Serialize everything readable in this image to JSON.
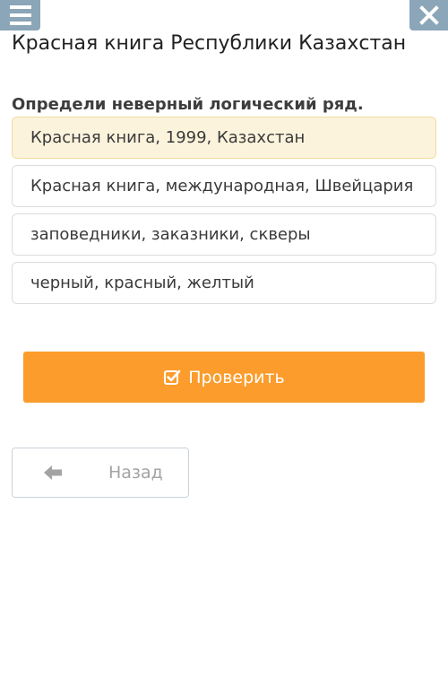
{
  "header": {
    "menu_icon": "hamburger-icon",
    "close_icon": "close-icon",
    "title": "Красная книга Республики Казахстан"
  },
  "question": {
    "text": "Определи неверный логический ряд."
  },
  "options": [
    {
      "label": "Красная книга, 1999, Казахстан",
      "selected": true
    },
    {
      "label": "Красная книга, международная, Швейцария",
      "selected": false
    },
    {
      "label": "заповедники, заказники, скверы",
      "selected": false
    },
    {
      "label": "черный, красный, желтый",
      "selected": false
    }
  ],
  "actions": {
    "check_label": "Проверить",
    "check_icon": "checkbox-icon",
    "back_label": "Назад",
    "back_icon": "arrow-left-icon"
  },
  "colors": {
    "header_buttons": "#8aa6b8",
    "check_button": "#fb9c2c",
    "selected_option_bg": "#fbf3dc",
    "selected_option_border": "#f1dc9f"
  }
}
